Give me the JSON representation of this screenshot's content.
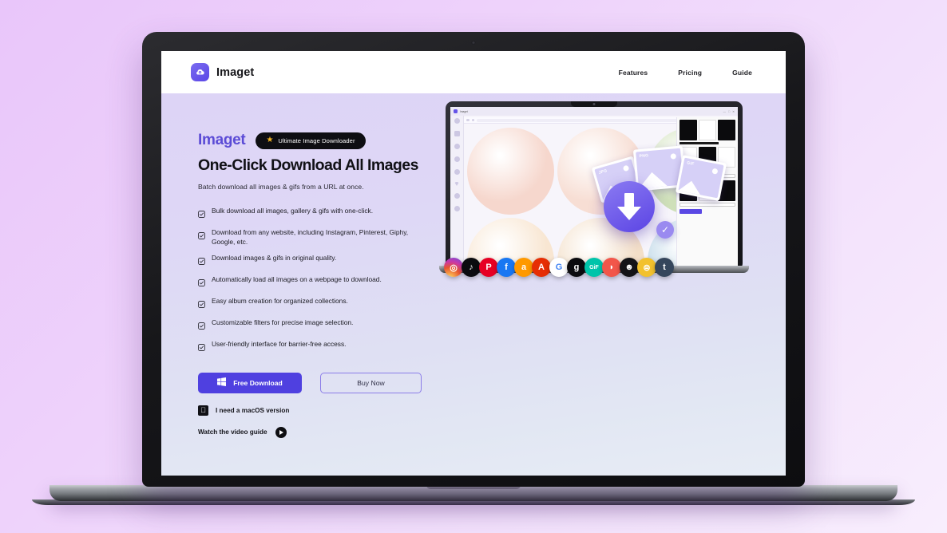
{
  "site": {
    "header": {
      "brand_name": "Imaget",
      "brand_icon": "cloud-download-icon",
      "nav": [
        {
          "label": "Features"
        },
        {
          "label": "Pricing"
        },
        {
          "label": "Guide"
        }
      ]
    },
    "hero": {
      "logo_text": "Imaget",
      "logo_color": "#5b4bd6",
      "badge": {
        "icon": "star-icon",
        "text": "Ultimate Image Downloader",
        "bg": "#0e0e12",
        "star_color": "#f5b723"
      },
      "headline": "One-Click Download All Images",
      "subhead": "Batch download all images & gifs from a URL at once.",
      "features": [
        {
          "icon": "checkbox-checked-icon",
          "text": "Bulk download all images, gallery & gifs with one-click."
        },
        {
          "icon": "checkbox-checked-icon",
          "text": "Download from any website, including Instagram, Pinterest, Giphy, Google, etc."
        },
        {
          "icon": "checkbox-checked-icon",
          "text": "Download images & gifs in original quality."
        },
        {
          "icon": "checkbox-checked-icon",
          "text": "Automatically load all images on a webpage to download."
        },
        {
          "icon": "checkbox-checked-icon",
          "text": "Easy album creation for organized collections."
        },
        {
          "icon": "checkbox-checked-icon",
          "text": "Customizable filters for precise image selection."
        },
        {
          "icon": "checkbox-checked-icon",
          "text": "User-friendly interface for barrier-free access."
        }
      ],
      "primary_button": {
        "label": "Free Download",
        "icon": "windows-icon",
        "bg": "#4f40e0"
      },
      "secondary_button": {
        "label": "Buy Now",
        "border": "#8b7de8"
      },
      "macos_link": {
        "icon": "apple-icon",
        "label": "I need a macOS version"
      },
      "video_link": {
        "label": "Watch the video guide",
        "icon": "play-icon"
      }
    },
    "product_shot": {
      "app_title": "Imaget",
      "download_badge_icon": "download-arrow-icon",
      "verified_icon": "check-circle-icon",
      "format_cards": [
        {
          "label": "JPG"
        },
        {
          "label": "PNG"
        },
        {
          "label": "GIF"
        }
      ],
      "thumbnail_colors": [
        "#f6d7cd",
        "#f7ded4",
        "#cfe0b9",
        "#f8e6d2",
        "#f3dfc8",
        "#bcd6e6",
        "#f6d9c6",
        "#f2d2d8",
        "#dcecd5",
        "#f9e3c4",
        "#f4cfd6",
        "#e7d9f0"
      ],
      "social_icons": [
        {
          "name": "instagram-icon",
          "glyph": "◎",
          "bg": "radial-gradient(circle at 30% 110%, #fdd35c 5%, #e8552d 45%, #c837ab 70%, #6f4cd8 95%)"
        },
        {
          "name": "tiktok-icon",
          "glyph": "♪",
          "bg": "#0b0b0f"
        },
        {
          "name": "pinterest-icon",
          "glyph": "P",
          "bg": "#e60023"
        },
        {
          "name": "facebook-icon",
          "glyph": "f",
          "bg": "#1877f2"
        },
        {
          "name": "amazon-icon",
          "glyph": "a",
          "bg": "#ff9900"
        },
        {
          "name": "aliexpress-icon",
          "glyph": "A",
          "bg": "#e62e04"
        },
        {
          "name": "google-icon",
          "glyph": "G",
          "bg": "#ffffff"
        },
        {
          "name": "giphy-icon",
          "glyph": "g",
          "bg": "#0b0b0f"
        },
        {
          "name": "gif-icon",
          "glyph": "GiF",
          "bg": "#00c4aa"
        },
        {
          "name": "patreon-icon",
          "glyph": "◗",
          "bg": "#f2564a"
        },
        {
          "name": "grindr-icon",
          "glyph": "☻",
          "bg": "#141417"
        },
        {
          "name": "coin-icon",
          "glyph": "⊜",
          "bg": "#f2c12e"
        },
        {
          "name": "tumblr-icon",
          "glyph": "t",
          "bg": "#35465c"
        }
      ]
    }
  },
  "theme": {
    "page_bg_start": "#e9c6fa",
    "page_bg_end": "#f8eefd",
    "hero_bg_start": "#ddd4f6",
    "hero_bg_end": "#e7ecf5",
    "accent": "#4f40e0"
  }
}
